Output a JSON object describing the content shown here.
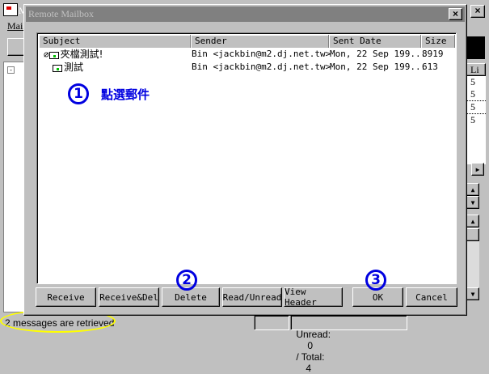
{
  "main_window": {
    "title_partial": "M",
    "menu": [
      "Mail"
    ],
    "right_column_header": "Li",
    "right_column_values": [
      "5",
      "5",
      "5",
      "5"
    ]
  },
  "dialog": {
    "title": "Remote Mailbox",
    "columns": [
      "Subject",
      "Sender",
      "Sent Date",
      "Size"
    ],
    "rows": [
      {
        "subject": "夾檔測試!",
        "sender": "Bin <jackbin@m2.dj.net.tw>",
        "date": "Mon, 22 Sep 199...",
        "size": "8919",
        "attachment": true
      },
      {
        "subject": "測試",
        "sender": "Bin <jackbin@m2.dj.net.tw>",
        "date": "Mon, 22 Sep 199...",
        "size": "613",
        "attachment": false
      }
    ],
    "buttons": {
      "receive": "Receive",
      "receive_del": "Receive&Del",
      "delete": "Delete",
      "read_unread": "Read/Unread",
      "view_header": "View Header",
      "ok": "OK",
      "cancel": "Cancel"
    }
  },
  "annotations": {
    "step1": "1",
    "step1_text": "點選郵件",
    "step2": "2",
    "step3": "3",
    "color": "#0000e0",
    "highlight": "#ffff00"
  },
  "status": {
    "message": "2 messages are retrieved",
    "unread_label": "Unread:",
    "unread": "0",
    "total_label": "/ Total:",
    "total": "4"
  }
}
